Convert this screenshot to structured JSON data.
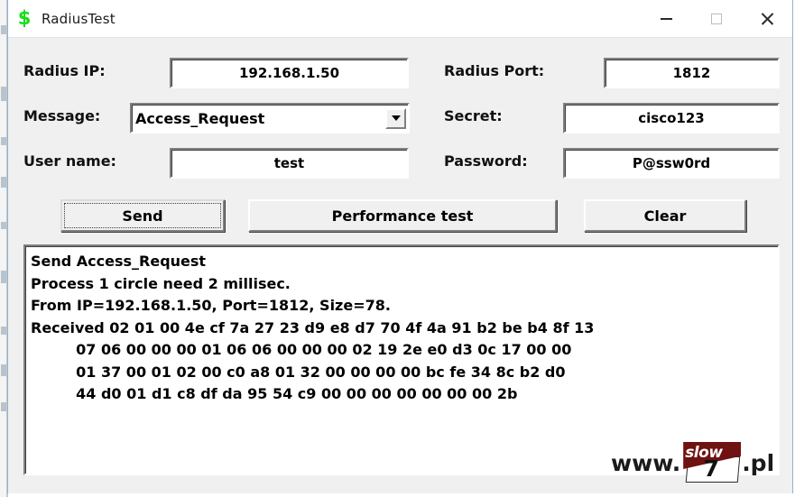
{
  "window": {
    "title": "RadiusTest",
    "icon": "dollar-sign-icon",
    "controls": {
      "minimize": "—",
      "maximize": "□",
      "close": "✕"
    }
  },
  "form": {
    "radius_ip": {
      "label": "Radius IP:",
      "value": "192.168.1.50"
    },
    "radius_port": {
      "label": "Radius Port:",
      "value": "1812"
    },
    "message": {
      "label": "Message:",
      "value": "Access_Request"
    },
    "secret": {
      "label": "Secret:",
      "value": "cisco123"
    },
    "user_name": {
      "label": "User name:",
      "value": "test"
    },
    "password": {
      "label": "Password:",
      "value": "P@ssw0rd"
    }
  },
  "buttons": {
    "send": "Send",
    "performance_test": "Performance test",
    "clear": "Clear"
  },
  "log": {
    "text": "Send Access_Request\nProcess 1 circle need 2 millisec.\nFrom IP=192.168.1.50, Port=1812, Size=78.\nReceived 02 01 00 4e cf 7a 27 23 d9 e8 d7 70 4f 4a 91 b2 be b4 8f 13\n         07 06 00 00 00 01 06 06 00 00 00 02 19 2e e0 d3 0c 17 00 00\n         01 37 00 01 02 00 c0 a8 01 32 00 00 00 00 bc fe 34 8c b2 d0\n         44 d0 01 d1 c8 df da 95 54 c9 00 00 00 00 00 00 00 2b"
  },
  "watermark": {
    "prefix": "www.",
    "logo_text": "slow",
    "logo_number": "7",
    "suffix": ".pl"
  },
  "colors": {
    "window_bg": "#f0f0f0",
    "titlebar_bg": "#ffffff",
    "field_bg": "#ffffff",
    "icon_green": "#16e016",
    "logo_dark_red": "#6e1212"
  }
}
